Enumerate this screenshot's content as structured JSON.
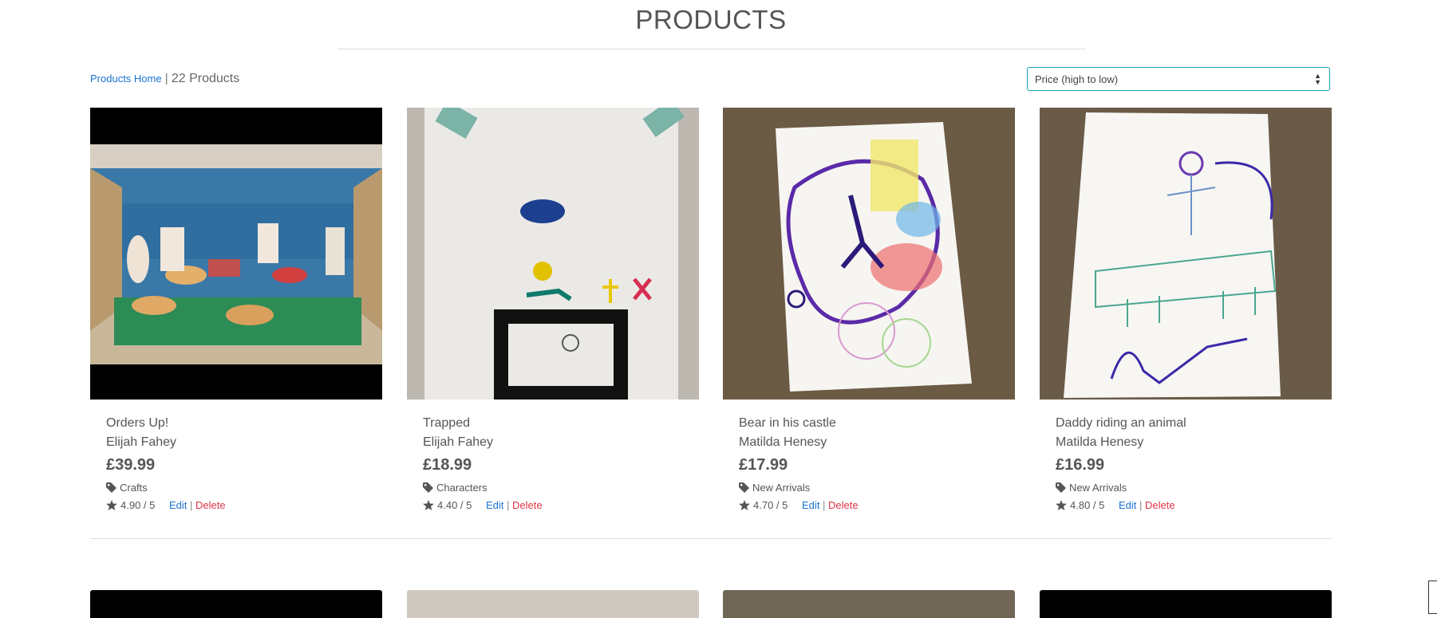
{
  "header": {
    "title": "PRODUCTS"
  },
  "toolbar": {
    "home_link": "Products Home",
    "separator": "|",
    "count": "22 Products",
    "sort_value": "Price (high to low)"
  },
  "products": [
    {
      "name": "Orders Up!",
      "artist": "Elijah Fahey",
      "price": "£39.99",
      "category": "Crafts",
      "rating": "4.90 / 5",
      "edit": "Edit",
      "sep": "|",
      "delete": "Delete"
    },
    {
      "name": "Trapped",
      "artist": "Elijah Fahey",
      "price": "£18.99",
      "category": "Characters",
      "rating": "4.40 / 5",
      "edit": "Edit",
      "sep": "|",
      "delete": "Delete"
    },
    {
      "name": "Bear in his castle",
      "artist": "Matilda Henesy",
      "price": "£17.99",
      "category": "New Arrivals",
      "rating": "4.70 / 5",
      "edit": "Edit",
      "sep": "|",
      "delete": "Delete"
    },
    {
      "name": "Daddy riding an animal",
      "artist": "Matilda Henesy",
      "price": "£16.99",
      "category": "New Arrivals",
      "rating": "4.80 / 5",
      "edit": "Edit",
      "sep": "|",
      "delete": "Delete"
    }
  ],
  "icons": {
    "tag": "tag-icon",
    "star": "star-icon",
    "sort": "sort-arrows-icon"
  },
  "colors": {
    "link": "#1a73d1",
    "delete": "#dc3545",
    "select_border": "#17a2b8"
  }
}
